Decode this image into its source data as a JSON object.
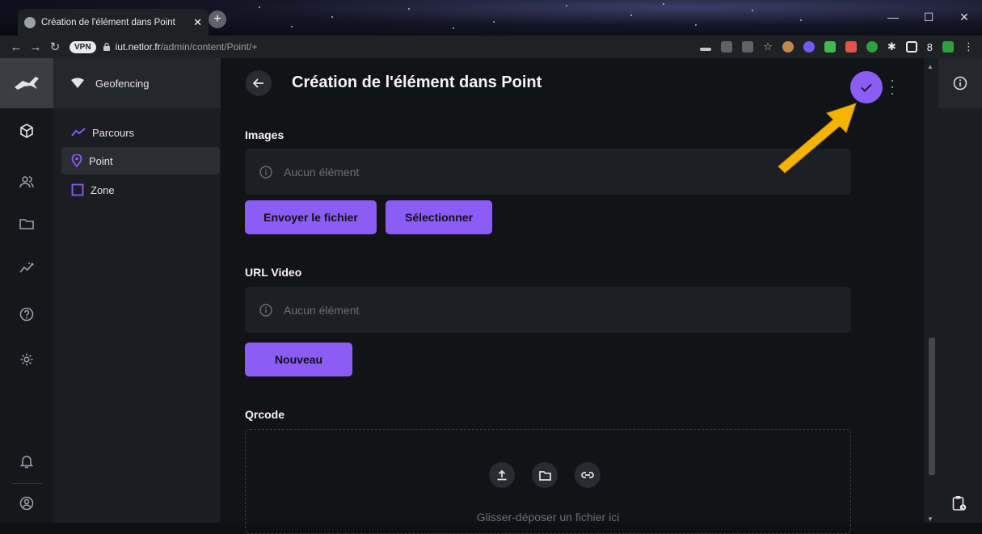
{
  "browser": {
    "tab_title": "Création de l'élément dans Point",
    "tab_close": "✕",
    "new_tab": "+",
    "vpn_badge": "VPN",
    "url_host": "iut.netlor.fr",
    "url_path": "/admin/content/Point/+",
    "window_min": "—",
    "window_max": "☐",
    "window_close": "✕"
  },
  "sidebar": {
    "project_name": "Geofencing",
    "items": [
      {
        "label": "Parcours",
        "icon": "line-chart-icon",
        "active": false
      },
      {
        "label": "Point",
        "icon": "map-pin-icon",
        "active": true
      },
      {
        "label": "Zone",
        "icon": "square-icon",
        "active": false
      }
    ]
  },
  "header": {
    "title": "Création de l'élément dans Point"
  },
  "fields": {
    "images": {
      "label": "Images",
      "empty_text": "Aucun élément",
      "upload_button": "Envoyer le fichier",
      "select_button": "Sélectionner"
    },
    "video": {
      "label": "URL Video",
      "empty_text": "Aucun élément",
      "new_button": "Nouveau"
    },
    "qrcode": {
      "label": "Qrcode",
      "drop_text": "Glisser-déposer un fichier ici"
    }
  },
  "colors": {
    "accent": "#8b5cf6",
    "annotation_arrow": "#f5b400"
  }
}
